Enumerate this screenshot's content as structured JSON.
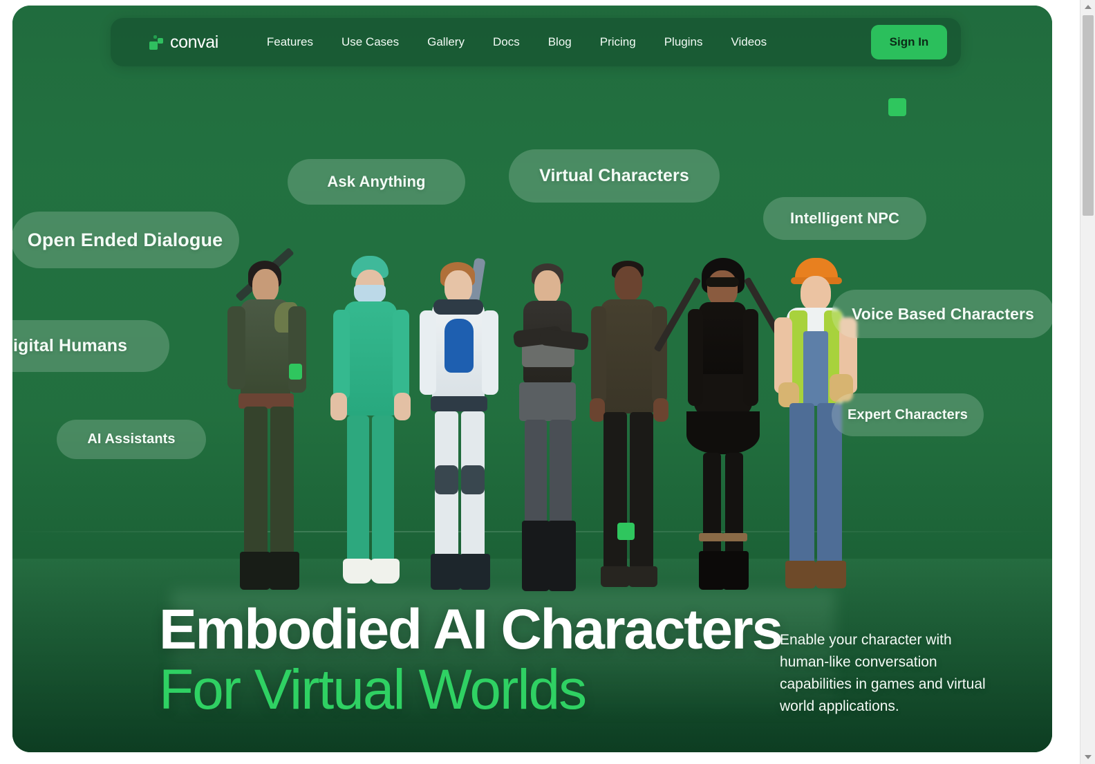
{
  "browser": {
    "scrollbar": {
      "up_arrow": "scroll-up",
      "down_arrow": "scroll-down"
    }
  },
  "theme": {
    "page_bg": "#1f6b3c",
    "nav_bg": "#185632",
    "accent_green": "#2fc65e",
    "headline_green": "#2fd163",
    "signin_bg": "#2bbf5c",
    "signin_text": "#0b2a17",
    "pill_bg": "rgba(236,252,242,0.20)",
    "text_white": "#ffffff"
  },
  "navbar": {
    "brand": {
      "name": "convai",
      "mark": "convai-logo-squares"
    },
    "links": [
      {
        "label": "Features"
      },
      {
        "label": "Use Cases"
      },
      {
        "label": "Gallery"
      },
      {
        "label": "Docs"
      },
      {
        "label": "Blog"
      },
      {
        "label": "Pricing"
      },
      {
        "label": "Plugins"
      },
      {
        "label": "Videos"
      }
    ],
    "signin_label": "Sign In"
  },
  "hero": {
    "pills": [
      {
        "id": "ask",
        "label": "Ask Anything"
      },
      {
        "id": "virtual",
        "label": "Virtual Characters"
      },
      {
        "id": "intelligent",
        "label": "Intelligent NPC"
      },
      {
        "id": "open_ended",
        "label": "Open Ended Dialogue"
      },
      {
        "id": "digital",
        "label": "Digital Humans"
      },
      {
        "id": "voice",
        "label": "Voice Based Characters"
      },
      {
        "id": "ai",
        "label": "AI Assistants"
      },
      {
        "id": "expert",
        "label": "Expert Characters"
      }
    ],
    "headline_line1": "Embodied AI Characters",
    "headline_line2": "For Virtual Worlds",
    "subcopy": "Enable your character with human-like conversation capabilities in games and virtual world applications.",
    "characters": [
      {
        "name": "armored-warrior"
      },
      {
        "name": "surgeon"
      },
      {
        "name": "sci-fi-soldier"
      },
      {
        "name": "punk-rogue"
      },
      {
        "name": "businessman"
      },
      {
        "name": "gothic-ninja"
      },
      {
        "name": "construction-worker"
      }
    ],
    "accent_squares": 3
  }
}
